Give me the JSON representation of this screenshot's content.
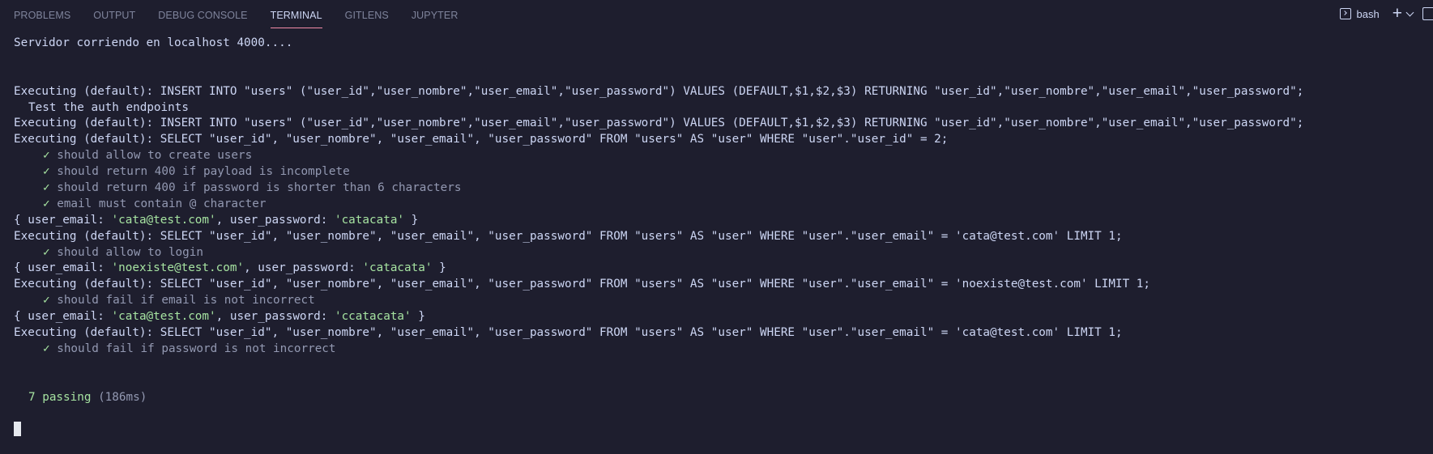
{
  "tabbar": {
    "tabs": [
      {
        "label": "PROBLEMS"
      },
      {
        "label": "OUTPUT"
      },
      {
        "label": "DEBUG CONSOLE"
      },
      {
        "label": "TERMINAL",
        "active": true
      },
      {
        "label": "GITLENS"
      },
      {
        "label": "JUPYTER"
      }
    ],
    "shell_label": "bash"
  },
  "terminal": {
    "server": "Servidor corriendo en localhost 4000....",
    "insert1": "Executing (default): INSERT INTO \"users\" (\"user_id\",\"user_nombre\",\"user_email\",\"user_password\") VALUES (DEFAULT,$1,$2,$3) RETURNING \"user_id\",\"user_nombre\",\"user_email\",\"user_password\";",
    "suite_title": "Test the auth endpoints",
    "insert2": "Executing (default): INSERT INTO \"users\" (\"user_id\",\"user_nombre\",\"user_email\",\"user_password\") VALUES (DEFAULT,$1,$2,$3) RETURNING \"user_id\",\"user_nombre\",\"user_email\",\"user_password\";",
    "select_by_id": "Executing (default): SELECT \"user_id\", \"user_nombre\", \"user_email\", \"user_password\" FROM \"users\" AS \"user\" WHERE \"user\".\"user_id\" = 2;",
    "check_mark": "✓",
    "test1": "should allow to create users",
    "test2": "should return 400 if payload is incomplete",
    "test3": "should return 400 if password is shorter than 6 characters",
    "test4": "email must contain @ character",
    "obj_open": "{ user_email: ",
    "obj_mid": ", user_password: ",
    "obj_close": " }",
    "login1_email": "'cata@test.com'",
    "login1_password": "'catacata'",
    "select_email1": "Executing (default): SELECT \"user_id\", \"user_nombre\", \"user_email\", \"user_password\" FROM \"users\" AS \"user\" WHERE \"user\".\"user_email\" = 'cata@test.com' LIMIT 1;",
    "test5": "should allow to login",
    "login2_email": "'noexiste@test.com'",
    "login2_password": "'catacata'",
    "select_email2": "Executing (default): SELECT \"user_id\", \"user_nombre\", \"user_email\", \"user_password\" FROM \"users\" AS \"user\" WHERE \"user\".\"user_email\" = 'noexiste@test.com' LIMIT 1;",
    "test6": "should fail if email is not incorrect",
    "login3_email": "'cata@test.com'",
    "login3_password": "'ccatacata'",
    "select_email3": "Executing (default): SELECT \"user_id\", \"user_nombre\", \"user_email\", \"user_password\" FROM \"users\" AS \"user\" WHERE \"user\".\"user_email\" = 'cata@test.com' LIMIT 1;",
    "test7": "should fail if password is not incorrect",
    "passing_count": "7 passing",
    "passing_time": "(186ms)"
  },
  "colors": {
    "background": "#1e1e2e",
    "text": "#cdd6f4",
    "success": "#a6e3a1",
    "dim": "#9399b2",
    "active_tab_underline": "#f38ba8"
  },
  "icons": {
    "shell": "terminal-icon",
    "new_terminal": "plus-icon",
    "dropdown": "chevron-down-icon",
    "split": "split-terminal-icon"
  }
}
